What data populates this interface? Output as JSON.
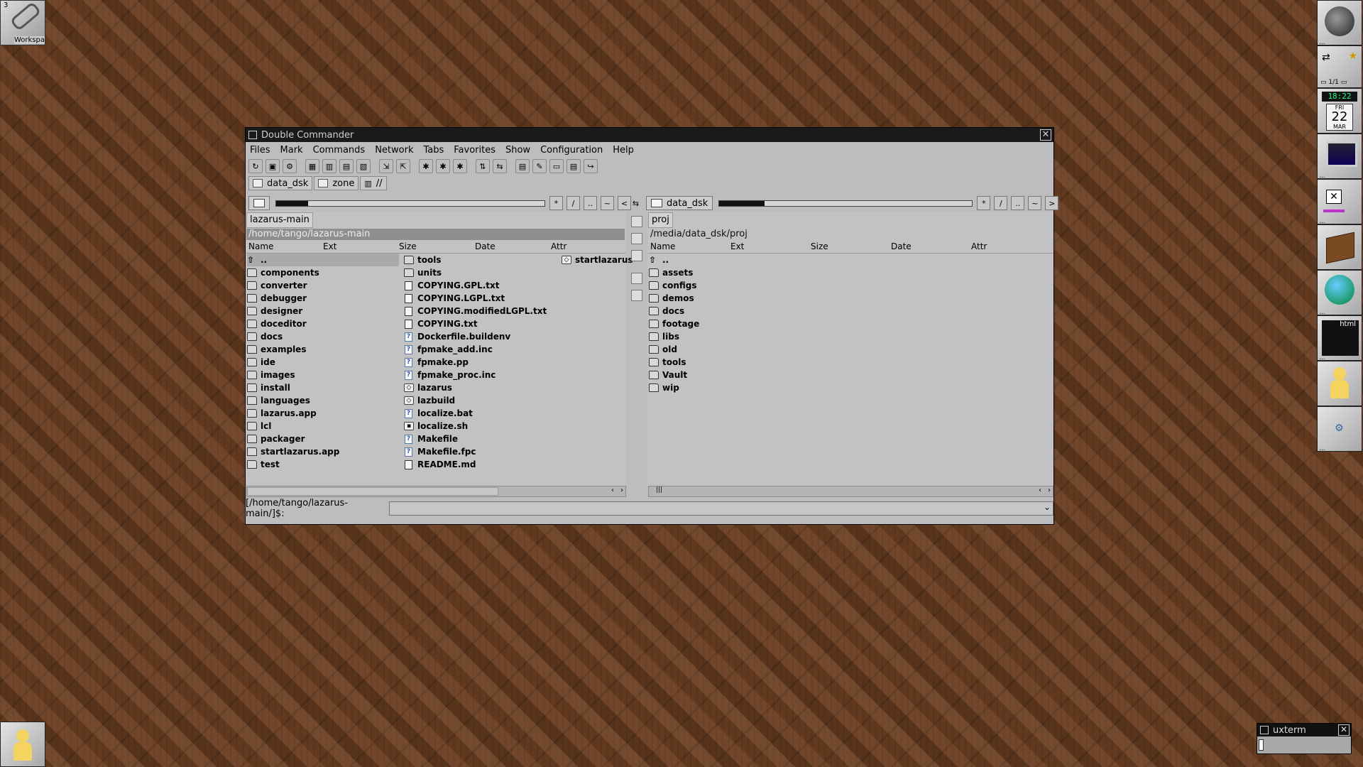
{
  "workspace": {
    "number": "3",
    "label": "Workspa"
  },
  "window": {
    "title": "Double Commander"
  },
  "menu": [
    "Files",
    "Mark",
    "Commands",
    "Network",
    "Tabs",
    "Favorites",
    "Show",
    "Configuration",
    "Help"
  ],
  "toolbar_icons": [
    "refresh-icon",
    "terminal-icon",
    "options-icon",
    "brief-view-icon",
    "columns-view-icon",
    "thumbnails-view-icon",
    "flat-view-icon",
    "copy-icon",
    "move-icon",
    "pack-icon",
    "unpack-icon",
    "test-archive-icon",
    "sync-dirs-icon",
    "compare-icon",
    "multi-rename-icon",
    "split-icon",
    "combine-icon",
    "edit-icon",
    "goto-icon"
  ],
  "drive_tabs": [
    {
      "label": "data_dsk"
    },
    {
      "label": "zone"
    },
    {
      "label": "//"
    }
  ],
  "left": {
    "nav": [
      "*",
      "/",
      "..",
      "~",
      "<"
    ],
    "tab": "lazarus-main",
    "path": "/home/tango/lazarus-main",
    "columns": [
      "Name",
      "Ext",
      "Size",
      "Date",
      "Attr"
    ],
    "col1": [
      {
        "name": "..",
        "icon": "up"
      },
      {
        "name": "components",
        "icon": "folder"
      },
      {
        "name": "converter",
        "icon": "folder"
      },
      {
        "name": "debugger",
        "icon": "folder"
      },
      {
        "name": "designer",
        "icon": "folder"
      },
      {
        "name": "doceditor",
        "icon": "folder"
      },
      {
        "name": "docs",
        "icon": "folder"
      },
      {
        "name": "examples",
        "icon": "folder"
      },
      {
        "name": "ide",
        "icon": "folder"
      },
      {
        "name": "images",
        "icon": "folder"
      },
      {
        "name": "install",
        "icon": "folder"
      },
      {
        "name": "languages",
        "icon": "folder"
      },
      {
        "name": "lazarus.app",
        "icon": "folder"
      },
      {
        "name": "lcl",
        "icon": "folder"
      },
      {
        "name": "packager",
        "icon": "folder"
      },
      {
        "name": "startlazarus.app",
        "icon": "folder"
      },
      {
        "name": "test",
        "icon": "folder"
      }
    ],
    "col2": [
      {
        "name": "tools",
        "icon": "folder"
      },
      {
        "name": "units",
        "icon": "folder"
      },
      {
        "name": "COPYING.GPL.txt",
        "icon": "file"
      },
      {
        "name": "COPYING.LGPL.txt",
        "icon": "file"
      },
      {
        "name": "COPYING.modifiedLGPL.txt",
        "icon": "file"
      },
      {
        "name": "COPYING.txt",
        "icon": "file"
      },
      {
        "name": "Dockerfile.buildenv",
        "icon": "unknown"
      },
      {
        "name": "fpmake_add.inc",
        "icon": "unknown"
      },
      {
        "name": "fpmake.pp",
        "icon": "unknown"
      },
      {
        "name": "fpmake_proc.inc",
        "icon": "unknown"
      },
      {
        "name": "lazarus",
        "icon": "exec"
      },
      {
        "name": "lazbuild",
        "icon": "exec"
      },
      {
        "name": "localize.bat",
        "icon": "unknown"
      },
      {
        "name": "localize.sh",
        "icon": "script"
      },
      {
        "name": "Makefile",
        "icon": "unknown"
      },
      {
        "name": "Makefile.fpc",
        "icon": "unknown"
      },
      {
        "name": "README.md",
        "icon": "file"
      }
    ],
    "col3": [
      {
        "name": "startlazarus",
        "icon": "exec"
      }
    ]
  },
  "right": {
    "drive": "data_dsk",
    "nav": [
      "*",
      "/",
      "..",
      "~",
      ">"
    ],
    "tab": "proj",
    "path": "/media/data_dsk/proj",
    "columns": [
      "Name",
      "Ext",
      "Size",
      "Date",
      "Attr"
    ],
    "items": [
      {
        "name": "..",
        "icon": "up"
      },
      {
        "name": "assets",
        "icon": "folder"
      },
      {
        "name": "configs",
        "icon": "folder"
      },
      {
        "name": "demos",
        "icon": "folder"
      },
      {
        "name": "docs",
        "icon": "folder"
      },
      {
        "name": "footage",
        "icon": "folder"
      },
      {
        "name": "libs",
        "icon": "folder"
      },
      {
        "name": "old",
        "icon": "folder"
      },
      {
        "name": "tools",
        "icon": "folder"
      },
      {
        "name": "Vault",
        "icon": "folder"
      },
      {
        "name": "wip",
        "icon": "folder"
      }
    ]
  },
  "cmdline": {
    "prompt": "[/home/tango/lazarus-main/]$:",
    "value": ""
  },
  "dock": {
    "clock_time": "18:22",
    "cal_day_name": "FRI",
    "cal_day": "22",
    "cal_month": "MAR",
    "pager": "1/1",
    "html_label": "html"
  },
  "uxterm": {
    "title": "uxterm"
  }
}
